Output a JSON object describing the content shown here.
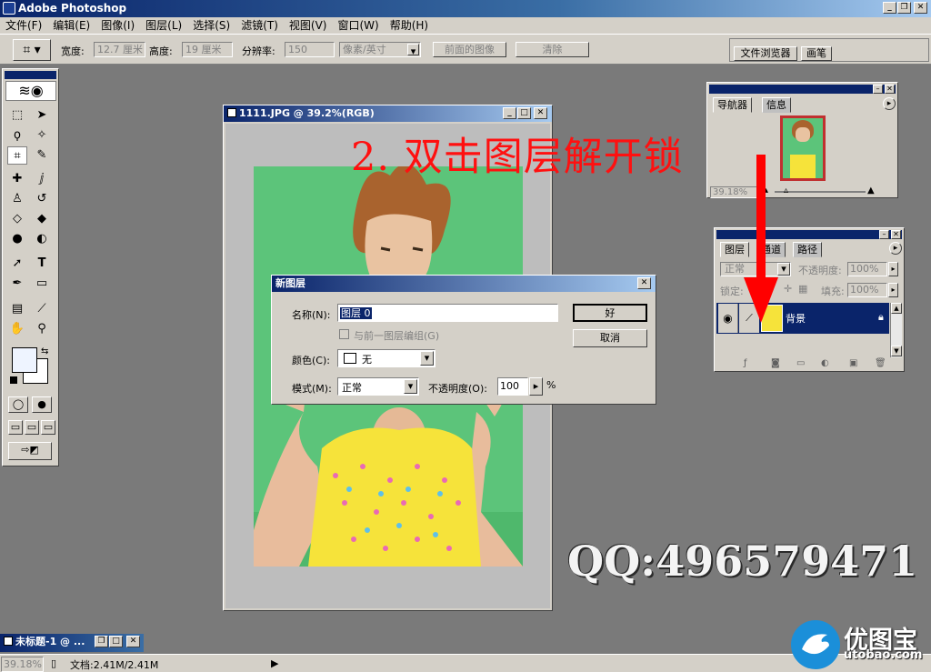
{
  "app": {
    "title": "Adobe Photoshop"
  },
  "menu": [
    "文件(F)",
    "编辑(E)",
    "图像(I)",
    "图层(L)",
    "选择(S)",
    "滤镜(T)",
    "视图(V)",
    "窗口(W)",
    "帮助(H)"
  ],
  "options": {
    "width_label": "宽度:",
    "width_value": "12.7 厘米",
    "height_label": "高度:",
    "height_value": "19 厘米",
    "res_label": "分辨率:",
    "res_value": "150",
    "unit_value": "像素/英寸",
    "front_image_btn": "前面的图像",
    "clear_btn": "清除",
    "file_browser_tab": "文件浏览器",
    "brushes_tab": "画笔"
  },
  "document": {
    "title": "1111.JPG @ 39.2%(RGB)"
  },
  "dialog": {
    "title": "新图层",
    "name_label": "名称(N):",
    "name_value": "图层 0",
    "group_checkbox": "与前一图层编组(G)",
    "color_label": "颜色(C):",
    "color_value": "无",
    "mode_label": "模式(M):",
    "mode_value": "正常",
    "opacity_label": "不透明度(O):",
    "opacity_value": "100",
    "opacity_unit": "%",
    "ok_button": "好",
    "cancel_button": "取消"
  },
  "navigator": {
    "tab_nav": "导航器",
    "tab_info": "信息",
    "zoom": "39.18%"
  },
  "layers": {
    "tab_layers": "图层",
    "tab_channels": "通道",
    "tab_paths": "路径",
    "blend_mode": "正常",
    "opacity_label": "不透明度:",
    "opacity_value": "100%",
    "lock_label": "锁定:",
    "fill_label": "填充:",
    "fill_value": "100%",
    "layer_name": "背景"
  },
  "minidoc": {
    "title": "未标题-1 @ ..."
  },
  "status": {
    "zoom": "39.18%",
    "doc_info": "文档:2.41M/2.41M"
  },
  "annotation": "2. 双击图层解开锁",
  "qq": "QQ:496579471",
  "watermark": {
    "name": "优图宝",
    "url": "utobao.com"
  }
}
